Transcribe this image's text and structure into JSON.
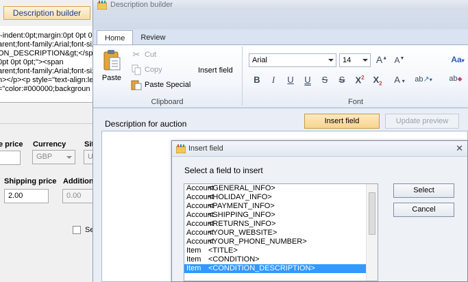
{
  "background_app": {
    "desc_builder_button": "Description builder",
    "html_lines": [
      "t-indent:0pt;margin:0pt 0pt 0p",
      "arent;font-family:Arial;font-siz",
      "ON_DESCRIPTION&gt;</span",
      "0pt 0pt 0pt;\"><span",
      "arent;font-family:Arial;font-siz",
      "n></p><p style=\"text-align:le",
      "=\"color:#000000;backgroun"
    ],
    "labels": {
      "price": "e price",
      "currency": "Currency",
      "site": "Sit",
      "shipping_price": "Shipping price",
      "additional": "Addition",
      "checkbox": "Se"
    },
    "currency_value": "GBP",
    "site_value": "U",
    "shipping_price_value": "2.00",
    "additional_value": "0.00"
  },
  "window": {
    "title": "Description builder",
    "tabs": [
      "Home",
      "Review"
    ],
    "clipboard": {
      "paste": "Paste",
      "cut": "Cut",
      "copy": "Copy",
      "paste_special": "Paste Special",
      "insert_field": "Insert field",
      "group_label": "Clipboard"
    },
    "font": {
      "family": "Arial",
      "size": "14",
      "group_label": "Font",
      "grow": "A",
      "shrink": "A",
      "bold": "B",
      "italic": "I",
      "underline": "U",
      "double_underline": "U",
      "strike": "S",
      "double_strike": "S",
      "superscript": "X",
      "superscript_mark": "2",
      "subscript": "X",
      "subscript_mark": "2",
      "color": "A",
      "highlight": "ab",
      "styles": "Aa",
      "clear": "ab"
    },
    "desc_label": "Description for auction",
    "insert_field_button": "Insert field",
    "update_preview_button": "Update preview"
  },
  "dialog": {
    "title": "Insert field",
    "close": "✕",
    "prompt": "Select a field to insert",
    "fields": [
      {
        "cat": "Account",
        "name": "<GENERAL_INFO>"
      },
      {
        "cat": "Account",
        "name": "<HOLIDAY_INFO>"
      },
      {
        "cat": "Account",
        "name": "<PAYMENT_INFO>"
      },
      {
        "cat": "Account",
        "name": "<SHIPPING_INFO>"
      },
      {
        "cat": "Account",
        "name": "<RETURNS_INFO>"
      },
      {
        "cat": "Account",
        "name": "<YOUR_WEBSITE>"
      },
      {
        "cat": "Account",
        "name": "<YOUR_PHONE_NUMBER>"
      },
      {
        "cat": "Item",
        "name": "<TITLE>"
      },
      {
        "cat": "Item",
        "name": "<CONDITION>"
      },
      {
        "cat": "Item",
        "name": "<CONDITION_DESCRIPTION>"
      }
    ],
    "selected_index": 9,
    "select_button": "Select",
    "cancel_button": "Cancel"
  }
}
